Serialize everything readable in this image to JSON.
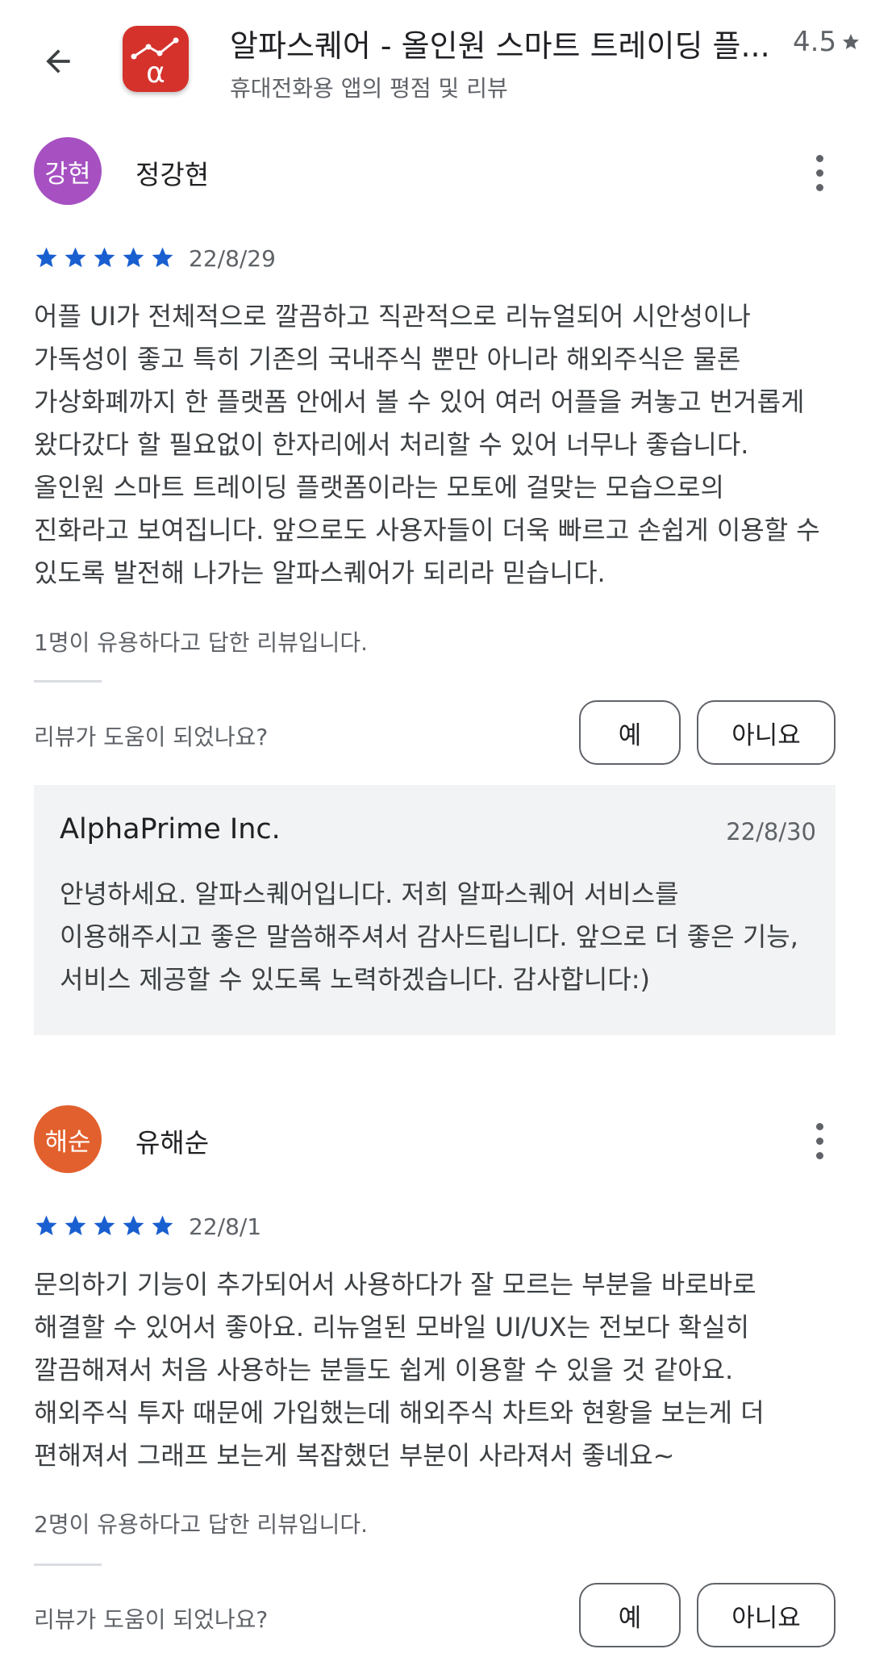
{
  "header": {
    "back_icon": "arrow-left-icon",
    "app_title": "알파스퀘어 - 올인원 스마트 트레이딩 플...",
    "subtitle": "휴대전화용 앱의 평점 및 리뷰",
    "rating": "4.5",
    "app_icon_color": "#d5322c",
    "app_icon_glyph": "α"
  },
  "reviews": [
    {
      "avatar_text": "강현",
      "avatar_color": "#a650c2",
      "user": "정강현",
      "stars": 5,
      "date": "22/8/29",
      "text": "어플 UI가 전체적으로 깔끔하고 직관적으로 리뉴얼되어 시안성이나\n가독성이 좋고 특히 기존의 국내주식 뿐만 아니라 해외주식은 물론\n가상화폐까지 한 플랫폼 안에서 볼 수 있어 여러 어플을 켜놓고 번거롭게\n왔다갔다 할 필요없이 한자리에서 처리할 수 있어 너무나 좋습니다.\n올인원 스마트 트레이딩 플랫폼이라는 모토에 걸맞는 모습으로의\n진화라고 보여집니다. 앞으로도 사용자들이 더욱 빠르고 손쉽게 이용할 수\n있도록 발전해 나가는 알파스퀘어가 되리라 믿습니다.",
      "helpful": "1명이 유용하다고 답한 리뷰입니다.",
      "question": "리뷰가 도움이 되었나요?",
      "yes": "예",
      "no": "아니요",
      "reply": {
        "developer": "AlphaPrime Inc.",
        "date": "22/8/30",
        "text": "안녕하세요. 알파스퀘어입니다. 저희 알파스퀘어 서비스를\n이용해주시고 좋은 말씀해주셔서 감사드립니다. 앞으로 더 좋은 기능,\n서비스 제공할 수 있도록 노력하겠습니다. 감사합니다:)"
      }
    },
    {
      "avatar_text": "해순",
      "avatar_color": "#e2602d",
      "user": "유해순",
      "stars": 5,
      "date": "22/8/1",
      "text": "문의하기 기능이 추가되어서 사용하다가 잘 모르는 부분을 바로바로\n해결할 수 있어서 좋아요. 리뉴얼된 모바일 UI/UX는 전보다 확실히\n깔끔해져서 처음 사용하는 분들도 쉽게 이용할 수 있을 것 같아요.\n해외주식 투자 때문에 가입했는데 해외주식 차트와 현황을 보는게 더\n편해져서 그래프 보는게 복잡했던 부분이 사라져서 좋네요~",
      "helpful": "2명이 유용하다고 답한 리뷰입니다.",
      "question": "리뷰가 도움이 되었나요?",
      "yes": "예",
      "no": "아니요"
    }
  ],
  "colors": {
    "star": "#1a5fd0",
    "text": "#202124",
    "muted": "#5f6368"
  }
}
